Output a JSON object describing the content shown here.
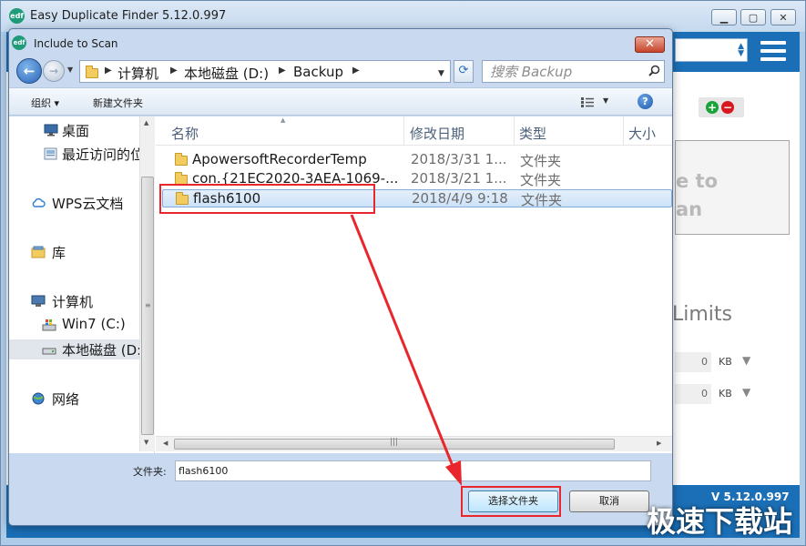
{
  "app": {
    "title": "Easy Duplicate Finder 5.12.0.997",
    "logo_text": "edf",
    "panel_lines": [
      "e to",
      "an"
    ],
    "limits_label": "Limits",
    "limit_rows": [
      {
        "value": "0",
        "unit": "KB"
      },
      {
        "value": "0",
        "unit": "KB"
      }
    ],
    "version": "V 5.12.0.997",
    "colors": {
      "accent": "#1b6fb6",
      "add": "#1aa33a",
      "remove": "#d7181f"
    }
  },
  "dialog": {
    "title": "Include to Scan",
    "close_glyph": "✕",
    "breadcrumb": [
      "计算机",
      "本地磁盘 (D:)",
      "Backup"
    ],
    "search_placeholder": "搜索 Backup",
    "toolbar": {
      "organize": "组织 ▾",
      "new_folder": "新建文件夹"
    },
    "nav_items": [
      {
        "label": "桌面",
        "icon": "desktop-icon"
      },
      {
        "label": "最近访问的位置",
        "icon": "recent-places-icon"
      },
      {
        "label": "WPS云文档",
        "icon": "cloud-icon"
      },
      {
        "label": "库",
        "icon": "library-icon"
      },
      {
        "label": "计算机",
        "icon": "computer-icon"
      },
      {
        "label": "Win7 (C:)",
        "icon": "system-drive-icon"
      },
      {
        "label": "本地磁盘 (D:)",
        "icon": "drive-icon"
      },
      {
        "label": "网络",
        "icon": "network-icon"
      }
    ],
    "columns": {
      "name": "名称",
      "modified": "修改日期",
      "type": "类型",
      "size": "大小"
    },
    "files": [
      {
        "name": "ApowersoftRecorderTemp",
        "modified": "2018/3/31 1...",
        "type": "文件夹"
      },
      {
        "name": "con.{21EC2020-3AEA-1069-...",
        "modified": "2018/3/21 1...",
        "type": "文件夹"
      },
      {
        "name": "flash6100",
        "modified": "2018/4/9 9:18",
        "type": "文件夹"
      }
    ],
    "folder_label": "文件夹:",
    "folder_value": "flash6100",
    "select_button": "选择文件夹",
    "cancel_button": "取消"
  },
  "watermark": "极速下载站"
}
